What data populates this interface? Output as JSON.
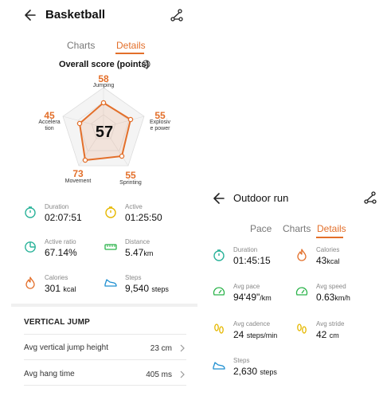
{
  "left": {
    "title": "Basketball",
    "tabs": [
      "Charts",
      "Details"
    ],
    "active_tab": "Details",
    "score_title": "Overall score (points)",
    "radar": {
      "center_score": "57",
      "axes": [
        {
          "value": "58",
          "label": "Jumping"
        },
        {
          "value": "55",
          "label": "Explosiv\ne power"
        },
        {
          "value": "55",
          "label": "Sprinting"
        },
        {
          "value": "73",
          "label": "Movement"
        },
        {
          "value": "45",
          "label": "Accelera\ntion"
        }
      ]
    },
    "stats": [
      {
        "label": "Duration",
        "value": "02:07:51",
        "unit": "",
        "icon": "stopwatch-icon",
        "color": "#2bb39a"
      },
      {
        "label": "Active",
        "value": "01:25:50",
        "unit": "",
        "icon": "stopwatch-icon",
        "color": "#e6b800"
      },
      {
        "label": "Active ratio",
        "value": "67.14%",
        "unit": "",
        "icon": "pie-icon",
        "color": "#2bb39a"
      },
      {
        "label": "Distance",
        "value": "5.47",
        "unit": "km",
        "icon": "ruler-icon",
        "color": "#2bb34a"
      },
      {
        "label": "Calories",
        "value": "301",
        "unit": "kcal",
        "icon": "flame-icon",
        "color": "#e36f2a"
      },
      {
        "label": "Steps",
        "value": "9,540",
        "unit": "steps",
        "icon": "shoe-icon",
        "color": "#1f8fd1"
      }
    ],
    "section_title": "VERTICAL JUMP",
    "rows": [
      {
        "label": "Avg vertical jump height",
        "value": "23 cm"
      },
      {
        "label": "Avg hang time",
        "value": "405 ms"
      }
    ]
  },
  "right": {
    "title": "Outdoor run",
    "tabs": [
      "Pace",
      "Charts",
      "Details"
    ],
    "active_tab": "Details",
    "stats": [
      {
        "label": "Duration",
        "value": "01:45:15",
        "unit": "",
        "icon": "stopwatch-icon",
        "color": "#2bb39a"
      },
      {
        "label": "Calories",
        "value": "43",
        "unit": "kcal",
        "icon": "flame-icon",
        "color": "#e36f2a"
      },
      {
        "label": "Avg pace",
        "value": "94'49\"",
        "unit": "/km",
        "icon": "gauge-icon",
        "color": "#2bb34a"
      },
      {
        "label": "Avg speed",
        "value": "0.63",
        "unit": "km/h",
        "icon": "gauge-icon",
        "color": "#2bb34a"
      },
      {
        "label": "Avg cadence",
        "value": "24",
        "unit": "steps/min",
        "icon": "footprints-icon",
        "color": "#e6b800"
      },
      {
        "label": "Avg stride",
        "value": "42",
        "unit": "cm",
        "icon": "footprints-icon",
        "color": "#e6b800"
      },
      {
        "label": "Steps",
        "value": "2,630",
        "unit": "steps",
        "icon": "shoe-icon",
        "color": "#1f8fd1"
      }
    ]
  },
  "colors": {
    "accent": "#e36f2a"
  }
}
